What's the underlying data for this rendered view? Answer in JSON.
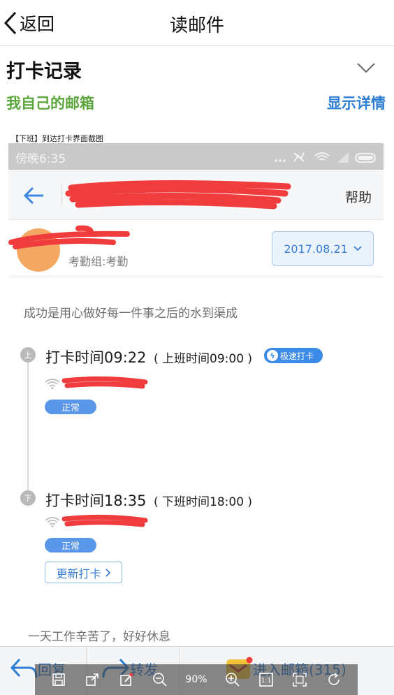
{
  "nav": {
    "back_label": "返回",
    "title": "读邮件"
  },
  "mail": {
    "subject": "打卡记录",
    "mailbox": "我自己的邮箱",
    "show_details": "显示详情",
    "attachment_caption": "【下班】到达打卡界面截图"
  },
  "screenshot": {
    "status_time": "傍晚6:35",
    "help": "帮助",
    "group": "考勤组:考勤",
    "date": "2017.08.21",
    "motto": "成功是用心做好每一件事之后的水到渠成",
    "records": [
      {
        "dot": "上",
        "time": "打卡时间09:22",
        "shift": "( 上班时间09:00 )",
        "badge": "极速打卡",
        "status": "正常"
      },
      {
        "dot": "下",
        "time": "打卡时间18:35",
        "shift": "( 下班时间18:00 )",
        "status": "正常"
      }
    ],
    "update_btn": "更新打卡",
    "farewell": "一天工作辛苦了，好好休息"
  },
  "bottombar": {
    "reply": "回复",
    "forward": "转发",
    "inbox": "进入邮箱(315)"
  },
  "viewer": {
    "zoom": "90%",
    "actual_size": "1:1"
  },
  "colors": {
    "accent_blue": "#2d7fd3",
    "green": "#5ba63c",
    "redaction": "#f03c3c",
    "avatar": "#f4a861"
  }
}
